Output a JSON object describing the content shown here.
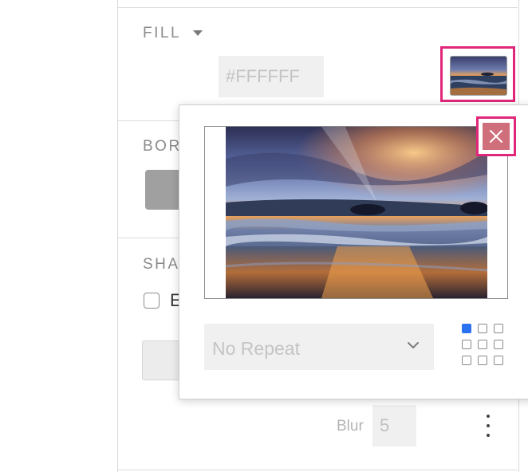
{
  "fill": {
    "title": "FILL",
    "color_value": "#FFFFFF",
    "thumbnail_icon": "image-thumbnail"
  },
  "border": {
    "title_partial": "BOR"
  },
  "shadow": {
    "title_partial": "SHA",
    "checkbox_label_partial": "E",
    "blur_label": "Blur",
    "blur_value": "5"
  },
  "image_popover": {
    "repeat_value": "No Repeat",
    "close_icon": "close-icon",
    "position_grid": {
      "rows": 3,
      "cols": 3,
      "selected": [
        0,
        0
      ]
    }
  },
  "colors": {
    "highlight": "#e0277a",
    "close_bg": "#cf6f7c",
    "grid_active": "#2a72f0"
  }
}
